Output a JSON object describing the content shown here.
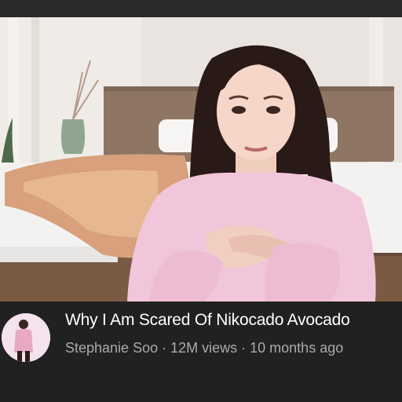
{
  "video": {
    "title": "Why I Am Scared Of Nikocado Avocado",
    "channel": "Stephanie Soo",
    "views": "12M views",
    "age": "10 months ago",
    "separator": "·"
  },
  "colors": {
    "background": "#212121",
    "title": "#ffffff",
    "subtitle": "#aaaaaa",
    "sweater": "#f2c6da"
  },
  "icons": {
    "avatar": "channel-avatar-thumbnail"
  }
}
